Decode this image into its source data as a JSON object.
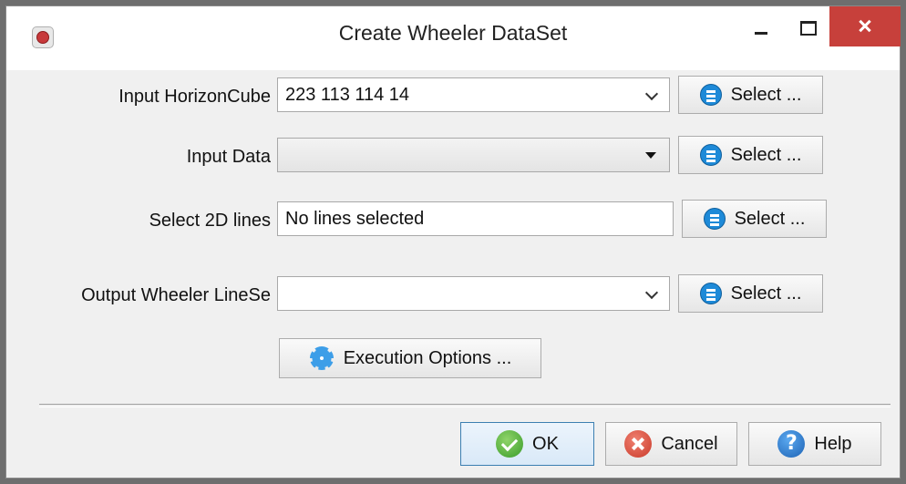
{
  "window": {
    "title": "Create Wheeler DataSet"
  },
  "form": {
    "input_horizoncube": {
      "label": "Input HorizonCube",
      "value": "223 113 114 14",
      "select_label": "Select ..."
    },
    "input_data": {
      "label": "Input Data",
      "value": "",
      "select_label": "Select ..."
    },
    "select_2d_lines": {
      "label": "Select 2D lines",
      "value": "No lines selected",
      "select_label": "Select ..."
    },
    "output_wheeler_lineset": {
      "label": "Output Wheeler LineSe",
      "value": "",
      "select_label": "Select ..."
    },
    "execution_options_label": "Execution Options ..."
  },
  "footer": {
    "ok_label": "OK",
    "cancel_label": "Cancel",
    "help_label": "Help"
  },
  "colors": {
    "close_button": "#c7403b",
    "accent_blue": "#1e8ad8",
    "dialog_bg": "#f0f0f0"
  }
}
